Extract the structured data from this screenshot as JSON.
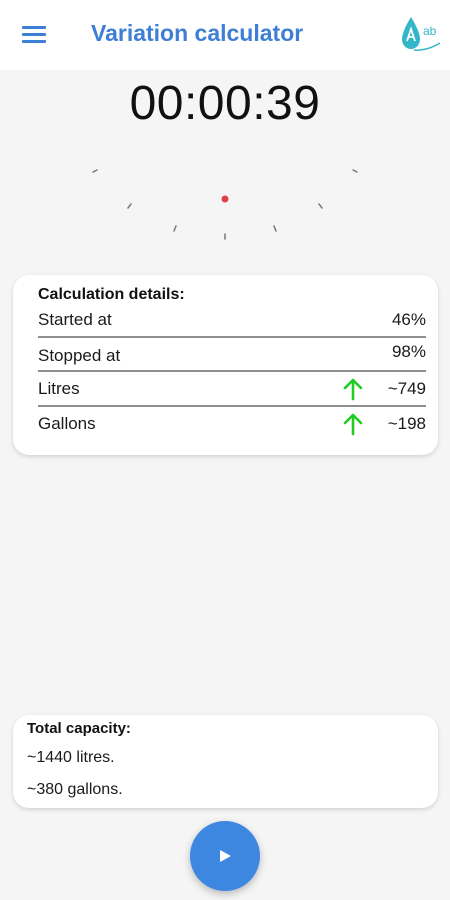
{
  "app": {
    "title": "Variation calculator",
    "accent_color": "#3d7fd6",
    "menu_icon": "hamburger-menu-icon",
    "logo_icon": "water-drop-logo-icon",
    "logo_text": "ab"
  },
  "timer": {
    "value": "00:00:39"
  },
  "gauge": {
    "indicator_color": "#e0404a"
  },
  "details": {
    "title": "Calculation details:",
    "rows": [
      {
        "label": "Started at",
        "value": "46%"
      },
      {
        "label": "Stopped at",
        "value": "98%"
      },
      {
        "label": "Litres",
        "value": "~749",
        "trend_icon": "arrow-up-icon"
      },
      {
        "label": "Gallons",
        "value": "~198",
        "trend_icon": "arrow-up-icon"
      }
    ],
    "trend_color": "#22cc22"
  },
  "total": {
    "title": "Total capacity:",
    "litres": "~1440 litres.",
    "gallons": "~380 gallons."
  },
  "fab": {
    "icon": "play-icon",
    "color": "#3d87e0"
  }
}
